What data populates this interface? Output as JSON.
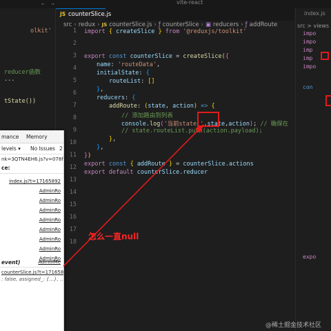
{
  "window": {
    "title": "vite-react"
  },
  "tab": {
    "label": "counterSlice.js",
    "icon": "JS"
  },
  "breadcrumb": [
    "src",
    "redux",
    "counterSlice.js",
    "counterSlice",
    "reducers",
    "addRoute"
  ],
  "code": {
    "lines": [
      {
        "n": "1"
      },
      {
        "n": "2"
      },
      {
        "n": "3"
      },
      {
        "n": "4"
      },
      {
        "n": "5"
      },
      {
        "n": "6"
      },
      {
        "n": "7"
      },
      {
        "n": "8"
      },
      {
        "n": "9"
      },
      {
        "n": "10"
      },
      {
        "n": "11"
      },
      {
        "n": "12"
      },
      {
        "n": "13"
      },
      {
        "n": "14"
      },
      {
        "n": "15"
      },
      {
        "n": "16"
      },
      {
        "n": "17"
      },
      {
        "n": "18"
      }
    ],
    "t": {
      "import": "import",
      "create_slice": "createSlice",
      "from": "from",
      "toolkit_str": "'@reduxjs/toolkit'",
      "export": "export",
      "const": "const",
      "counter_slice": "counterSlice",
      "name": "name",
      "route_data": "'routeData'",
      "initial_state": "initialState",
      "route_list": "routeList",
      "reducers": "reducers",
      "add_route": "addRoute",
      "state": "state",
      "action": "action",
      "comment_11": "// 添加路由到列表",
      "console": "console",
      "log": "log",
      "log_str": "'当前state:'",
      "comment_12": "// 确保在",
      "comment_13": "// state.routeList.push(action.payload);",
      "actions": "actions",
      "default": "default",
      "reducer": "reducer"
    }
  },
  "left_editor": {
    "line1": "olkit'",
    "line2": "reducer函数",
    "line3": "...",
    "line4": "tState())"
  },
  "right_editor": {
    "tab": "index.js",
    "breadcrumb": "src > views >",
    "imports": [
      "impo",
      "impo",
      "imp",
      "imp",
      "impo"
    ],
    "con": "con",
    "exp": "expo"
  },
  "devtools": {
    "tabs": [
      "mance",
      "Memory"
    ],
    "filter": "levels ▾",
    "issues": "No Issues",
    "issues_count": "2",
    "url_fragment": "nk=3QTN4EH6.js?v=078fa4",
    "ce": "ce:",
    "link_index": "index.js?t=17165892",
    "admin_links": [
      "AdminRo",
      "AdminRo",
      "AdminRo",
      "AdminRo",
      "AdminRo",
      "AdminRo",
      "AdminRo",
      "AdminRo"
    ],
    "event": "event)",
    "admin_me": "AdminMe",
    "link_counter": "counterSlice.js?t=171658",
    "state_preview": ": false, assigned_: {...}, ...}"
  },
  "annotation": {
    "text": "怎么一直null",
    "color": "#ff2424"
  },
  "watermark": "@稀土掘金技术社区"
}
